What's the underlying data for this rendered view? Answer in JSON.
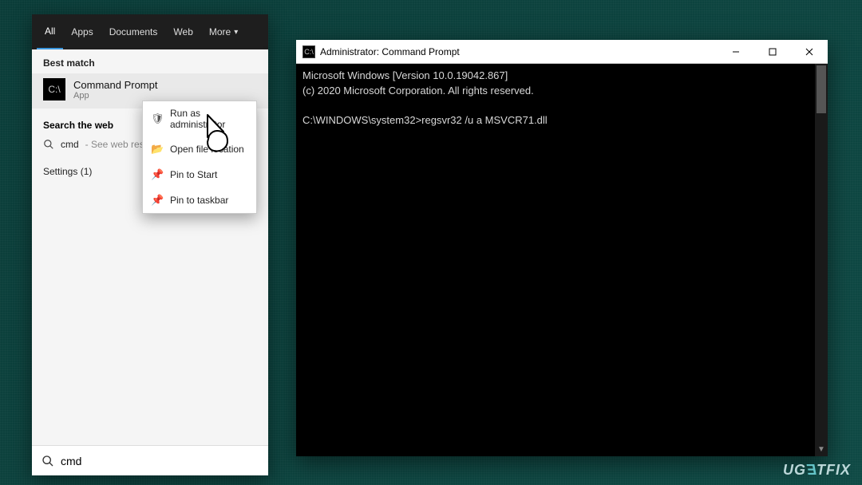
{
  "start": {
    "tabs": {
      "all": "All",
      "apps": "Apps",
      "documents": "Documents",
      "web": "Web",
      "more": "More"
    },
    "best_match_label": "Best match",
    "result": {
      "title": "Command Prompt",
      "subtitle": "App"
    },
    "search_web_label": "Search the web",
    "web_query": "cmd",
    "web_hint": " - See web results",
    "settings_label": "Settings (1)",
    "search_value": "cmd"
  },
  "context_menu": {
    "items": [
      {
        "label": "Run as administrator",
        "icon": "admin-shield-icon"
      },
      {
        "label": "Open file location",
        "icon": "folder-open-icon"
      },
      {
        "label": "Pin to Start",
        "icon": "pin-start-icon"
      },
      {
        "label": "Pin to taskbar",
        "icon": "pin-taskbar-icon"
      }
    ]
  },
  "cmd": {
    "title": "Administrator: Command Prompt",
    "lines": {
      "l1": "Microsoft Windows [Version 10.0.19042.867]",
      "l2": "(c) 2020 Microsoft Corporation. All rights reserved.",
      "blank": "",
      "prompt": "C:\\WINDOWS\\system32>",
      "command": "regsvr32 /u a MSVCR71.dll"
    }
  },
  "watermark": "UGETFIX"
}
